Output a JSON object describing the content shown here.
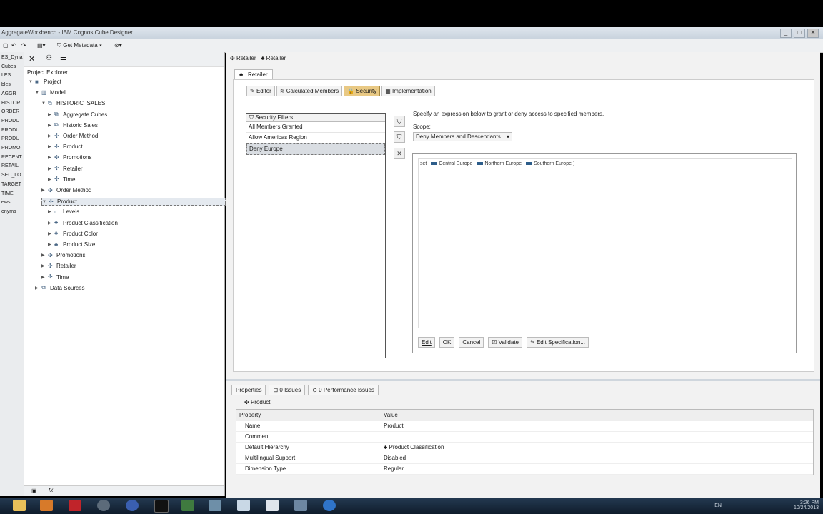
{
  "window": {
    "title": "AggregateWorkbench - IBM Cognos Cube Designer",
    "controls": [
      "_",
      "□",
      "✕"
    ]
  },
  "toolbar": {
    "get_metadata": "Get Metadata"
  },
  "left_strip": [
    "ES_Dyna",
    "Cubes_",
    "LES",
    "bles",
    "AGGR_",
    "HISTOR",
    "ORDER_",
    "PRODU",
    "PRODU",
    "PRODU",
    "PROMO",
    "RECENT",
    "RETAIL",
    "SEC_LO",
    "TARGET",
    "TIME",
    "ews",
    "onyms"
  ],
  "project_explorer": {
    "title": "Project Explorer",
    "tree": [
      {
        "label": "Project",
        "indent": 0,
        "arrow": "▼",
        "icon": "■"
      },
      {
        "label": "Model",
        "indent": 1,
        "arrow": "▼",
        "icon": "▥"
      },
      {
        "label": "HISTORIC_SALES",
        "indent": 2,
        "arrow": "▼",
        "icon": "⧉"
      },
      {
        "label": "Aggregate Cubes",
        "indent": 3,
        "arrow": "▶",
        "icon": "⧉"
      },
      {
        "label": "Historic Sales",
        "indent": 3,
        "arrow": "▶",
        "icon": "⧉"
      },
      {
        "label": "Order Method",
        "indent": 3,
        "arrow": "▶",
        "icon": "✣"
      },
      {
        "label": "Product",
        "indent": 3,
        "arrow": "▶",
        "icon": "✣"
      },
      {
        "label": "Promotions",
        "indent": 3,
        "arrow": "▶",
        "icon": "✣"
      },
      {
        "label": "Retailer",
        "indent": 3,
        "arrow": "▶",
        "icon": "✣"
      },
      {
        "label": "Time",
        "indent": 3,
        "arrow": "▶",
        "icon": "✣"
      },
      {
        "label": "Order Method",
        "indent": 2,
        "arrow": "▶",
        "icon": "✣"
      },
      {
        "label": "Product",
        "indent": 2,
        "arrow": "▼",
        "icon": "✣",
        "selected": true
      },
      {
        "label": "Levels",
        "indent": 3,
        "arrow": "▶",
        "icon": "▭"
      },
      {
        "label": "Product Classification",
        "indent": 3,
        "arrow": "▶",
        "icon": "♣"
      },
      {
        "label": "Product Color",
        "indent": 3,
        "arrow": "▶",
        "icon": "♣"
      },
      {
        "label": "Product Size",
        "indent": 3,
        "arrow": "▶",
        "icon": "♣"
      },
      {
        "label": "Promotions",
        "indent": 2,
        "arrow": "▶",
        "icon": "✣"
      },
      {
        "label": "Retailer",
        "indent": 2,
        "arrow": "▶",
        "icon": "✣"
      },
      {
        "label": "Time",
        "indent": 2,
        "arrow": "▶",
        "icon": "✣"
      },
      {
        "label": "Data Sources",
        "indent": 1,
        "arrow": "▶",
        "icon": "⧉"
      }
    ],
    "bottom_label": "fx"
  },
  "editor": {
    "breadcrumb": [
      "Retailer",
      "Retailer"
    ],
    "tab": "Retailer",
    "subtabs": [
      {
        "label": "Editor",
        "icon": "✎",
        "active": false
      },
      {
        "label": "Calculated Members",
        "icon": "≋",
        "active": false
      },
      {
        "label": "Security",
        "icon": "🔒",
        "active": true
      },
      {
        "label": "Implementation",
        "icon": "▦",
        "active": false
      }
    ],
    "filters_header": "Security Filters",
    "filters": [
      {
        "label": "All Members Granted",
        "selected": false
      },
      {
        "label": "Allow Americas Region",
        "selected": false
      },
      {
        "label": "Deny Europe",
        "selected": true
      }
    ],
    "instruction": "Specify an expression below to grant or deny access to specified members.",
    "scope_label": "Scope:",
    "scope_value": "Deny Members and Descendants",
    "expression": {
      "prefix": "set",
      "members": [
        "Central Europe",
        "Northern Europe",
        "Southern Europe"
      ],
      "suffix": ")"
    },
    "buttons": {
      "edit": "Edit",
      "ok": "OK",
      "cancel": "Cancel",
      "validate": "Validate",
      "edit_spec": "Edit Specification..."
    }
  },
  "bottom": {
    "tabs": [
      "Properties",
      "0 Issues",
      "0 Performance Issues"
    ],
    "object": "Product",
    "columns": [
      "Property",
      "Value"
    ],
    "rows": [
      [
        "Name",
        "Product"
      ],
      [
        "Comment",
        ""
      ],
      [
        "Default Hierarchy",
        "Product Classification"
      ],
      [
        "Multilingual Support",
        "Disabled"
      ],
      [
        "Dimension Type",
        "Regular"
      ]
    ]
  },
  "taskbar": {
    "lang": "EN",
    "time": "3:26 PM",
    "date": "10/24/2013"
  },
  "colors": {
    "accent": "#e9c984",
    "selection": "#d9dde2",
    "taskbar": "#1a2b3e"
  }
}
